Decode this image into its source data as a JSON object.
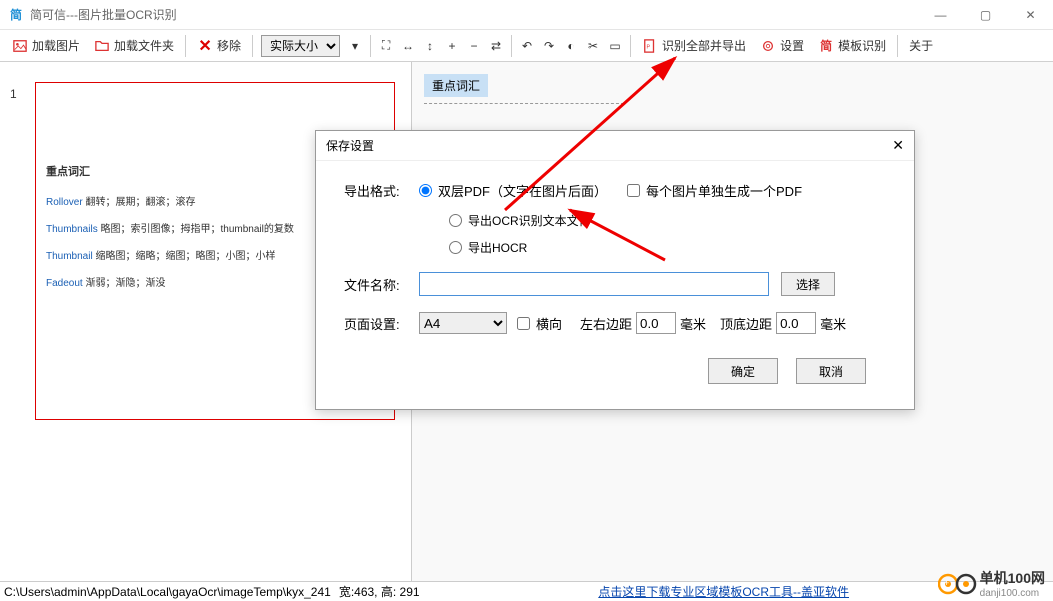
{
  "title": "简可信---图片批量OCR识别",
  "toolbar": {
    "load_image": "加载图片",
    "load_folder": "加载文件夹",
    "remove": "移除",
    "zoom_mode": "实际大小",
    "recognize_export": "识别全部并导出",
    "settings": "设置",
    "template": "模板识别",
    "about": "关于"
  },
  "thumbnail": {
    "index": "1",
    "title": "重点词汇",
    "entries": [
      {
        "k": "Rollover",
        "v": "翻转；展期；翻滚；滚存"
      },
      {
        "k": "Thumbnails",
        "v": "略图；索引图像；拇指甲；thumbnail的复数"
      },
      {
        "k": "Thumbnail",
        "v": "缩略图；缩略；缩图；略图；小图；小样"
      },
      {
        "k": "Fadeout",
        "v": "渐弱；渐隐；渐没"
      }
    ]
  },
  "preview": {
    "heading": "重点词汇"
  },
  "dialog": {
    "title": "保存设置",
    "format_label": "导出格式:",
    "opt_dual_pdf": "双层PDF（文字在图片后面）",
    "opt_each_pdf": "每个图片单独生成一个PDF",
    "opt_text": "导出OCR识别文本文件",
    "opt_hocr": "导出HOCR",
    "filename_label": "文件名称:",
    "filename_value": "",
    "browse": "选择",
    "pageset_label": "页面设置:",
    "page_size": "A4",
    "landscape": "横向",
    "lr_margin_label": "左右边距",
    "lr_margin": "0.0",
    "unit": "毫米",
    "tb_margin_label": "顶底边距",
    "tb_margin": "0.0",
    "ok": "确定",
    "cancel": "取消"
  },
  "status": {
    "path": "C:\\Users\\admin\\AppData\\Local\\gayaOcr\\imageTemp\\kyx_241",
    "dims": "宽:463, 高: 291",
    "link": "点击这里下载专业区域模板OCR工具--盖亚软件"
  },
  "watermark": {
    "name": "单机100网",
    "domain": "danji100.com"
  }
}
